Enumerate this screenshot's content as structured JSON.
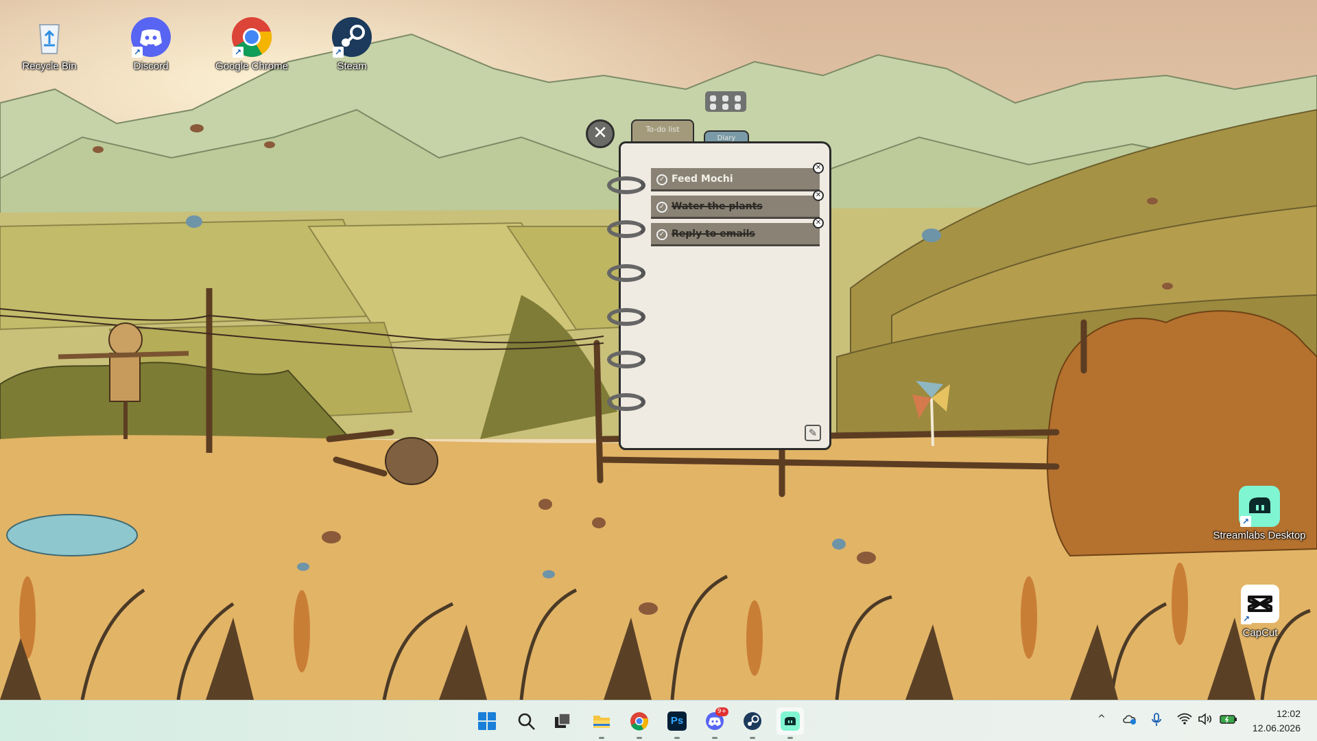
{
  "desktop": {
    "icons": [
      {
        "label": "Recycle Bin",
        "icon": "recycle-bin-icon"
      },
      {
        "label": "Discord",
        "icon": "discord-icon"
      },
      {
        "label": "Google Chrome",
        "icon": "chrome-icon"
      },
      {
        "label": "Steam",
        "icon": "steam-icon"
      },
      {
        "label": "Streamlabs Desktop",
        "icon": "streamlabs-icon"
      },
      {
        "label": "CapCut",
        "icon": "capcut-icon"
      }
    ]
  },
  "widget": {
    "close_symbol": "✕",
    "tabs": [
      {
        "label": "To-do list"
      },
      {
        "label": "Diary"
      }
    ],
    "todos": [
      {
        "text": "Feed Mochi",
        "done": false
      },
      {
        "text": "Water the plants",
        "done": true
      },
      {
        "text": "Reply to emails",
        "done": true
      }
    ],
    "edit_symbol": "✎"
  },
  "taskbar": {
    "apps": [
      {
        "name": "start",
        "icon": "windows-start-icon"
      },
      {
        "name": "search",
        "icon": "search-icon"
      },
      {
        "name": "task-view",
        "icon": "task-view-icon"
      },
      {
        "name": "file-explorer",
        "icon": "folder-icon"
      },
      {
        "name": "chrome",
        "icon": "chrome-icon"
      },
      {
        "name": "photoshop",
        "icon": "photoshop-icon",
        "text": "Ps"
      },
      {
        "name": "discord",
        "icon": "discord-icon",
        "badge": "9+"
      },
      {
        "name": "steam",
        "icon": "steam-icon"
      },
      {
        "name": "streamlabs",
        "icon": "streamlabs-icon"
      }
    ],
    "tray": {
      "chevron": "^",
      "time": "12:02",
      "date": "12.06.2026"
    }
  },
  "colors": {
    "taskbar_bg": "#e6f0ea",
    "notebook_paper": "#efebe2",
    "todo_item_bg": "#898275",
    "tab_todo": "#a39a7c",
    "tab_diary": "#7a9aa7"
  }
}
